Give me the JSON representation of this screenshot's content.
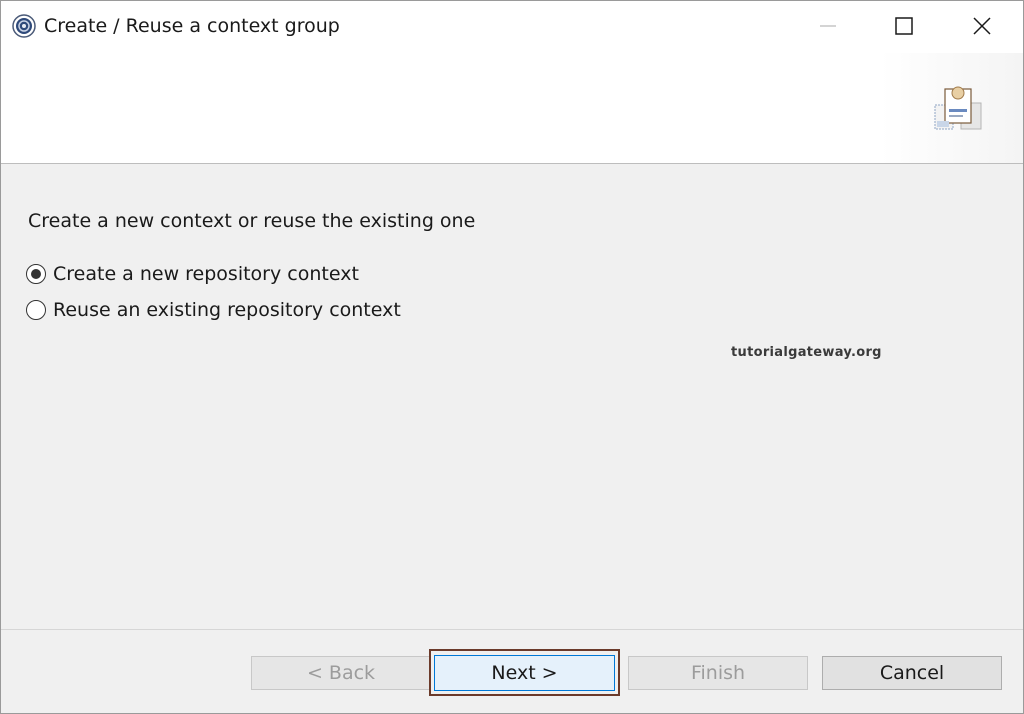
{
  "window": {
    "title": "Create / Reuse a context group"
  },
  "content": {
    "prompt": "Create a new context or reuse the existing one",
    "options": [
      {
        "label": "Create a new repository context",
        "selected": true
      },
      {
        "label": "Reuse an existing repository context",
        "selected": false
      }
    ],
    "watermark": "tutorialgateway.org"
  },
  "buttons": {
    "back": "< Back",
    "next": "Next >",
    "finish": "Finish",
    "cancel": "Cancel"
  },
  "icons": {
    "app": "talend-app-icon",
    "banner": "context-group-wizard-icon",
    "minimize": "minimize-icon",
    "maximize": "maximize-icon",
    "close": "close-icon"
  },
  "colors": {
    "focus_border": "#0078d7",
    "focus_highlight": "#6b3a2a",
    "disabled_text": "#9c9c9c"
  }
}
